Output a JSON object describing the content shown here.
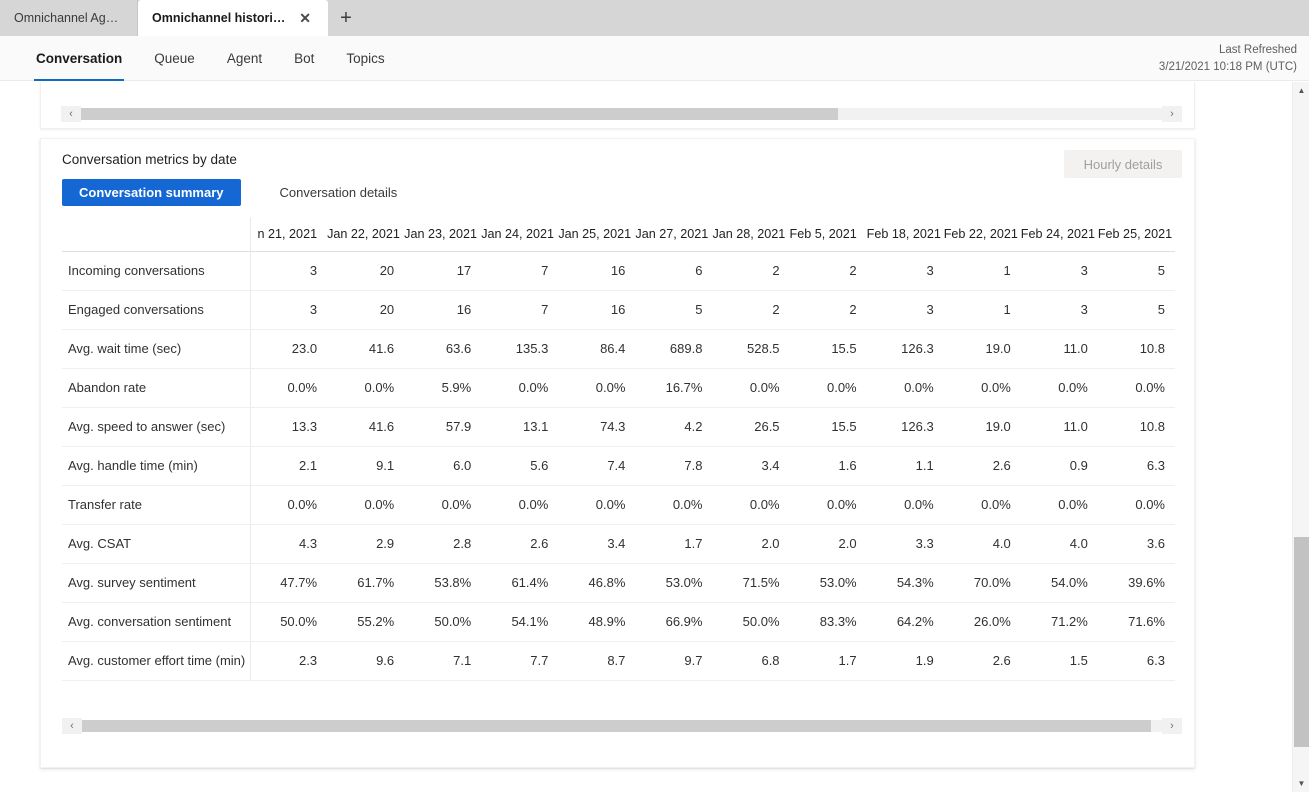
{
  "browser": {
    "tabs": [
      {
        "title": "Omnichannel Age...",
        "active": false
      },
      {
        "title": "Omnichannel historical an...",
        "active": true
      }
    ],
    "close_glyph": "✕",
    "newtab_glyph": "+"
  },
  "appnav": {
    "tabs": [
      {
        "label": "Conversation",
        "selected": true
      },
      {
        "label": "Queue",
        "selected": false
      },
      {
        "label": "Agent",
        "selected": false
      },
      {
        "label": "Bot",
        "selected": false
      },
      {
        "label": "Topics",
        "selected": false
      }
    ],
    "refresh_label": "Last Refreshed",
    "refresh_value": "3/21/2021 10:18 PM (UTC)",
    "accent": "#0f6cbd"
  },
  "top_scroll": {
    "left_arrow": "‹",
    "right_arrow": "›",
    "thumb_pct": 70
  },
  "card": {
    "title": "Conversation metrics by date",
    "hourly_details_label": "Hourly details",
    "pivot": [
      {
        "label": "Conversation summary",
        "selected": true
      },
      {
        "label": "Conversation details",
        "selected": false
      }
    ],
    "bottom_scroll": {
      "left_arrow": "‹",
      "right_arrow": "›",
      "thumb_pct": 99
    }
  },
  "chart_data": {
    "type": "table",
    "title": "Conversation metrics by date",
    "row_header": "",
    "categories": [
      "n 21, 2021",
      "Jan 22, 2021",
      "Jan 23, 2021",
      "Jan 24, 2021",
      "Jan 25, 2021",
      "Jan 27, 2021",
      "Jan 28, 2021",
      "Feb 5, 2021",
      "Feb 18, 2021",
      "Feb 22, 2021",
      "Feb 24, 2021",
      "Feb 25, 2021"
    ],
    "series": [
      {
        "name": "Incoming conversations",
        "values": [
          "3",
          "20",
          "17",
          "7",
          "16",
          "6",
          "2",
          "2",
          "3",
          "1",
          "3",
          "5"
        ]
      },
      {
        "name": "Engaged conversations",
        "values": [
          "3",
          "20",
          "16",
          "7",
          "16",
          "5",
          "2",
          "2",
          "3",
          "1",
          "3",
          "5"
        ]
      },
      {
        "name": "Avg. wait time (sec)",
        "values": [
          "23.0",
          "41.6",
          "63.6",
          "135.3",
          "86.4",
          "689.8",
          "528.5",
          "15.5",
          "126.3",
          "19.0",
          "11.0",
          "10.8"
        ]
      },
      {
        "name": "Abandon rate",
        "values": [
          "0.0%",
          "0.0%",
          "5.9%",
          "0.0%",
          "0.0%",
          "16.7%",
          "0.0%",
          "0.0%",
          "0.0%",
          "0.0%",
          "0.0%",
          "0.0%"
        ]
      },
      {
        "name": "Avg. speed to answer (sec)",
        "values": [
          "13.3",
          "41.6",
          "57.9",
          "13.1",
          "74.3",
          "4.2",
          "26.5",
          "15.5",
          "126.3",
          "19.0",
          "11.0",
          "10.8"
        ]
      },
      {
        "name": "Avg. handle time (min)",
        "values": [
          "2.1",
          "9.1",
          "6.0",
          "5.6",
          "7.4",
          "7.8",
          "3.4",
          "1.6",
          "1.1",
          "2.6",
          "0.9",
          "6.3"
        ]
      },
      {
        "name": "Transfer rate",
        "values": [
          "0.0%",
          "0.0%",
          "0.0%",
          "0.0%",
          "0.0%",
          "0.0%",
          "0.0%",
          "0.0%",
          "0.0%",
          "0.0%",
          "0.0%",
          "0.0%"
        ]
      },
      {
        "name": "Avg. CSAT",
        "values": [
          "4.3",
          "2.9",
          "2.8",
          "2.6",
          "3.4",
          "1.7",
          "2.0",
          "2.0",
          "3.3",
          "4.0",
          "4.0",
          "3.6"
        ]
      },
      {
        "name": "Avg. survey sentiment",
        "values": [
          "47.7%",
          "61.7%",
          "53.8%",
          "61.4%",
          "46.8%",
          "53.0%",
          "71.5%",
          "53.0%",
          "54.3%",
          "70.0%",
          "54.0%",
          "39.6%"
        ]
      },
      {
        "name": "Avg. conversation sentiment",
        "values": [
          "50.0%",
          "55.2%",
          "50.0%",
          "54.1%",
          "48.9%",
          "66.9%",
          "50.0%",
          "83.3%",
          "64.2%",
          "26.0%",
          "71.2%",
          "71.6%"
        ]
      },
      {
        "name": "Avg. customer effort time (min)",
        "values": [
          "2.3",
          "9.6",
          "7.1",
          "7.7",
          "8.7",
          "9.7",
          "6.8",
          "1.7",
          "1.9",
          "2.6",
          "1.5",
          "6.3"
        ]
      }
    ]
  },
  "vscroll": {
    "up_glyph": "▲",
    "down_glyph": "▼"
  }
}
